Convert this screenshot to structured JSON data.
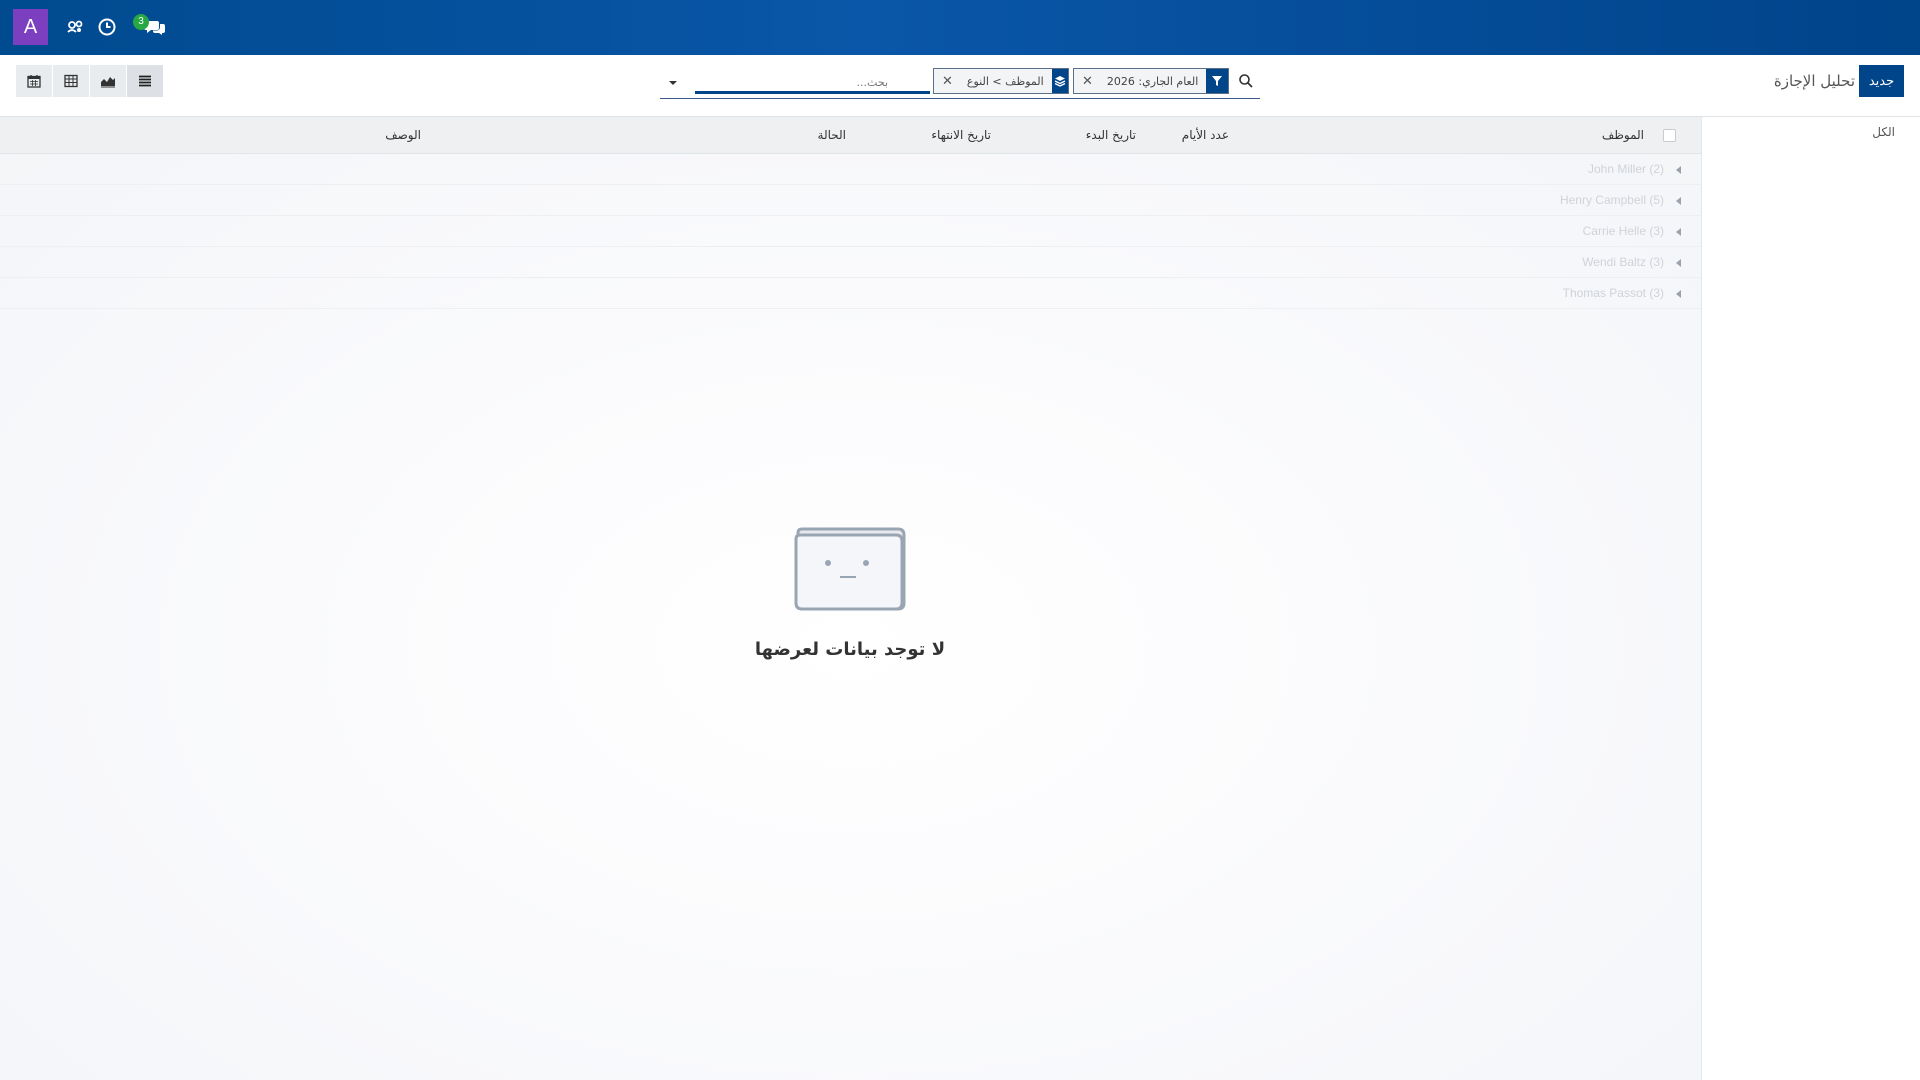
{
  "navbar": {
    "avatar_letter": "A",
    "chat_badge_count": "3",
    "icons": [
      "users-gear-icon",
      "clock-icon",
      "chat-icon"
    ],
    "brand_color": "#00448a",
    "avatar_color": "#7b3fbf"
  },
  "control_panel": {
    "new_button": "جديد",
    "title": "تحليل الإجازة",
    "search": {
      "placeholder": "بحث...",
      "facet_filter": "العام الجاري: 2026",
      "facet_groupby": "الموظف > النوع"
    },
    "views": [
      "list-view",
      "graph-view",
      "pivot-view",
      "calendar-view"
    ]
  },
  "sidebar": {
    "all_label": "الكل"
  },
  "list": {
    "columns": {
      "employee": "الموظف",
      "days": "عدد الأيام",
      "start_date": "تاريخ البدء",
      "end_date": "تاريخ الانتهاء",
      "status": "الحالة",
      "description": "الوصف"
    },
    "groups": [
      "John Miller (2)",
      "Henry Campbell (5)",
      "Carrie Helle (3)",
      "Wendi Baltz (3)",
      "Thomas Passot (3)"
    ]
  },
  "empty_state": {
    "message": "لا توجد بيانات لعرضها"
  }
}
